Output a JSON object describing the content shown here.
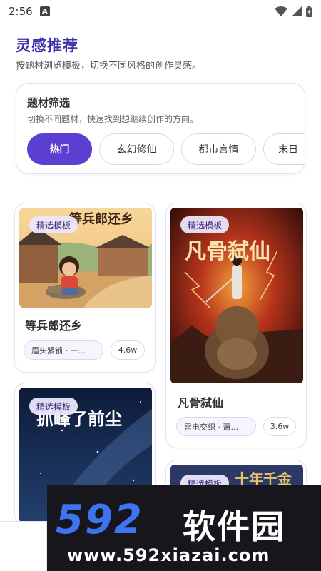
{
  "status_bar": {
    "time": "2:56",
    "notification_letter": "A"
  },
  "header": {
    "title": "灵感推荐",
    "subtitle": "按题材浏览模板，切换不同风格的创作灵感。"
  },
  "filter": {
    "title": "题材筛选",
    "description": "切换不同题材，快速找到想继续创作的方向。",
    "chips": [
      {
        "label": "热门",
        "active": true
      },
      {
        "label": "玄幻修仙",
        "active": false
      },
      {
        "label": "都市言情",
        "active": false
      },
      {
        "label": "末日",
        "active": false
      }
    ]
  },
  "cards": [
    {
      "badge": "精选模板",
      "cover_text": "等兵郎还乡",
      "title": "等兵郎还乡",
      "tag": "眉头紧锁 · 一...",
      "count": "4.6w"
    },
    {
      "badge": "精选模板",
      "cover_text": "凡骨弑仙",
      "title": "凡骨弑仙",
      "tag": "雷电交织 · 萧...",
      "count": "3.6w"
    },
    {
      "badge": "精选模板",
      "cover_text": "抓峰了前尘"
    },
    {
      "badge": "精选模板",
      "cover_text": "十年千金"
    }
  ],
  "watermark": {
    "logo": "592",
    "name": "软件园",
    "url": "www.592xiazai.com"
  },
  "colors": {
    "accent": "#5b3fd0",
    "title": "#3b2fa8",
    "watermark_blue": "#3f74f0"
  }
}
